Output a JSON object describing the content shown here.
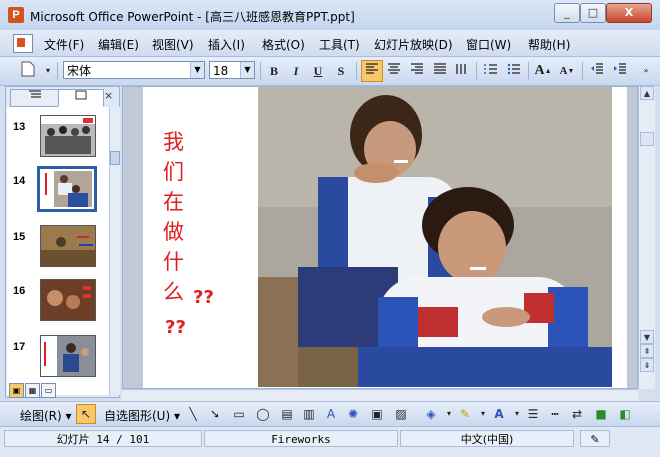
{
  "window": {
    "title": "Microsoft Office PowerPoint - [高三八班感恩教育PPT.ppt]",
    "app_icon_letter": "P",
    "min_symbol": "_",
    "max_symbol": "□",
    "close_symbol": "X"
  },
  "menu": {
    "items": [
      "文件(F)",
      "编辑(E)",
      "视图(V)",
      "插入(I)",
      "格式(O)",
      "工具(T)",
      "幻灯片放映(D)",
      "窗口(W)",
      "帮助(H)"
    ]
  },
  "toolbar": {
    "font_name": "宋体",
    "font_size": "18",
    "bold": "B",
    "italic": "I",
    "underline": "U",
    "shadow": "S",
    "grow_font": "A",
    "shrink_font": "A"
  },
  "left_panel": {
    "tab_outline_icon": "outline-tab-icon",
    "tab_slides_icon": "slides-tab-icon",
    "close": "×",
    "slides": [
      {
        "number": "13"
      },
      {
        "number": "14"
      },
      {
        "number": "15"
      },
      {
        "number": "16"
      },
      {
        "number": "17"
      }
    ]
  },
  "slide": {
    "text_chars": [
      "我",
      "们",
      "在",
      "做",
      "什",
      "么"
    ],
    "question_marks_1": "??",
    "question_marks_2": "??"
  },
  "drawing_toolbar": {
    "draw_label": "绘图(R)",
    "autoshapes_label": "自选图形(U)"
  },
  "status": {
    "slide_info": "幻灯片 14 / 101",
    "design": "Fireworks",
    "language": "中文(中国)"
  },
  "colors": {
    "slide_text": "#e02020",
    "selected_thumb_border": "#2c5fa8",
    "active_button": "#f9c66b"
  }
}
